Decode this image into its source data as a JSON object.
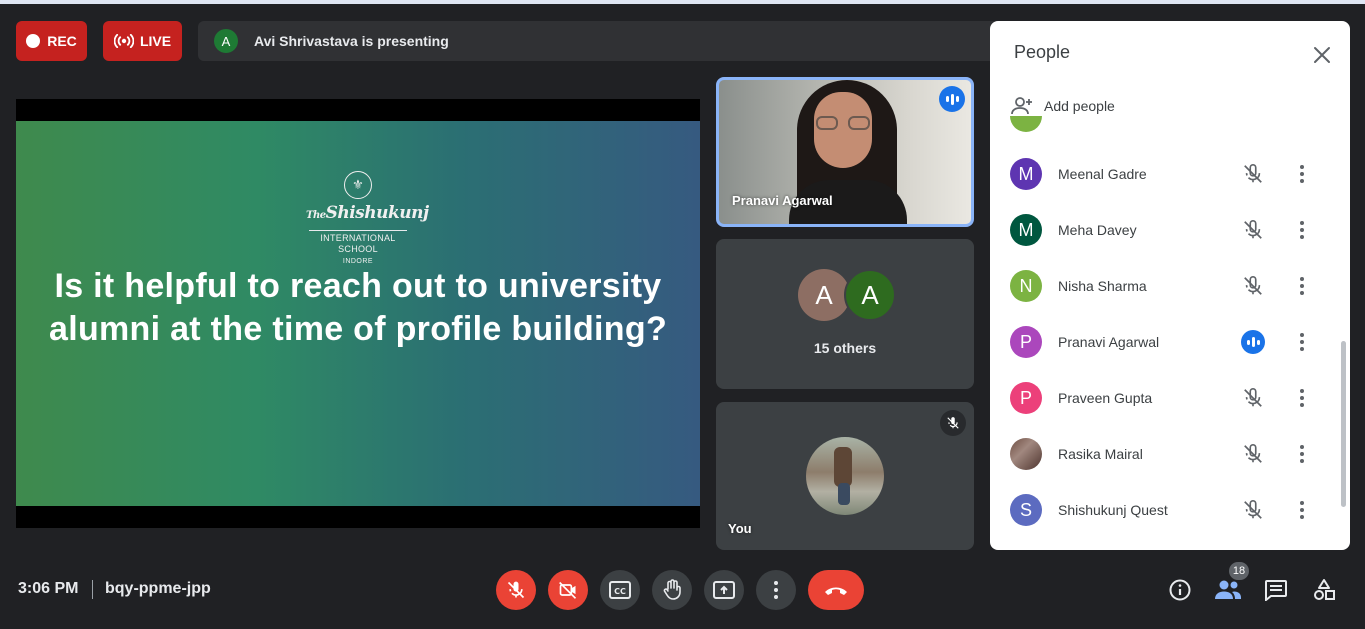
{
  "top_bar": {
    "rec_label": "REC",
    "live_label": "LIVE",
    "presenter_initial": "A",
    "presenting_text": "Avi Shrivastava is presenting"
  },
  "slide": {
    "logo_the": "The",
    "logo_name": "Shishukunj",
    "logo_sub": "INTERNATIONAL SCHOOL",
    "logo_city": "INDORE",
    "question": "Is it helpful to reach out to university alumni at the time of profile building?"
  },
  "tiles": {
    "speaker_name": "Pranavi Agarwal",
    "others_initial_1": "A",
    "others_initial_2": "A",
    "others_label": "15 others",
    "you_label": "You"
  },
  "people_panel": {
    "title": "People",
    "add_people_label": "Add people",
    "participants": [
      {
        "initial": "M",
        "name": "Meenal Gadre",
        "color": "#5e35b1",
        "mic": "muted"
      },
      {
        "initial": "M",
        "name": "Meha Davey",
        "color": "#00573f",
        "mic": "muted"
      },
      {
        "initial": "N",
        "name": "Nisha Sharma",
        "color": "#7cb342",
        "mic": "muted"
      },
      {
        "initial": "P",
        "name": "Pranavi Agarwal",
        "color": "#ab47bc",
        "mic": "speaking"
      },
      {
        "initial": "P",
        "name": "Praveen Gupta",
        "color": "#ec407a",
        "mic": "muted"
      },
      {
        "initial": "",
        "name": "Rasika Mairal",
        "color": "#6d4c41",
        "mic": "muted"
      },
      {
        "initial": "S",
        "name": "Shishukunj Quest",
        "color": "#5c6bc0",
        "mic": "muted"
      }
    ]
  },
  "bottom_bar": {
    "time": "3:06 PM",
    "meeting_code": "bqy-ppme-jpp",
    "participants_count": "18"
  },
  "colors": {
    "rec_red": "#c5221f",
    "end_call_red": "#ea4335",
    "speaking_blue": "#1a73e8"
  }
}
